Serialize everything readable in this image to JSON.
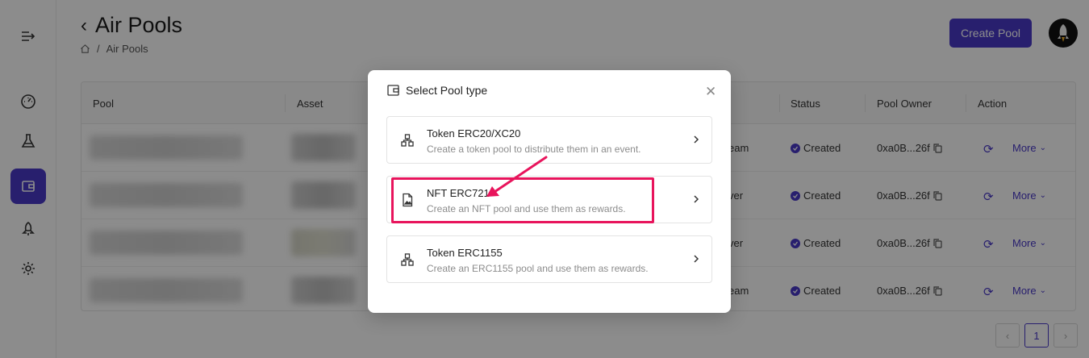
{
  "header": {
    "title": "Air Pools",
    "breadcrumb": "Air Pools",
    "create_button": "Create Pool"
  },
  "sidebar": {
    "items": [
      {
        "icon": "expand-menu-icon"
      },
      {
        "icon": "dashboard-gauge-icon"
      },
      {
        "icon": "flask-icon"
      },
      {
        "icon": "wallet-icon",
        "active": true
      },
      {
        "icon": "rocket-icon"
      },
      {
        "icon": "gear-icon"
      }
    ]
  },
  "table": {
    "columns": [
      "Pool",
      "Asset",
      "Status",
      "Pool Owner",
      "Action"
    ],
    "rows": [
      {
        "partial": "eam",
        "status": "Created",
        "owner": "0xa0B...26f",
        "more": "More"
      },
      {
        "partial": "ver",
        "status": "Created",
        "owner": "0xa0B...26f",
        "more": "More"
      },
      {
        "partial": "ver",
        "status": "Created",
        "owner": "0xa0B...26f",
        "more": "More"
      },
      {
        "partial": "eam",
        "status": "Created",
        "owner": "0xa0B...26f",
        "more": "More"
      }
    ]
  },
  "pagination": {
    "current": "1"
  },
  "modal": {
    "title": "Select Pool type",
    "options": [
      {
        "title": "Token ERC20/XC20",
        "desc": "Create a token pool to distribute them in an event."
      },
      {
        "title": "NFT ERC721",
        "desc": "Create an NFT pool and use them as rewards."
      },
      {
        "title": "Token ERC1155",
        "desc": "Create an ERC1155 pool and use them as rewards."
      }
    ]
  },
  "colors": {
    "accent": "#4a3ac9",
    "annotation": "#e8145c"
  }
}
